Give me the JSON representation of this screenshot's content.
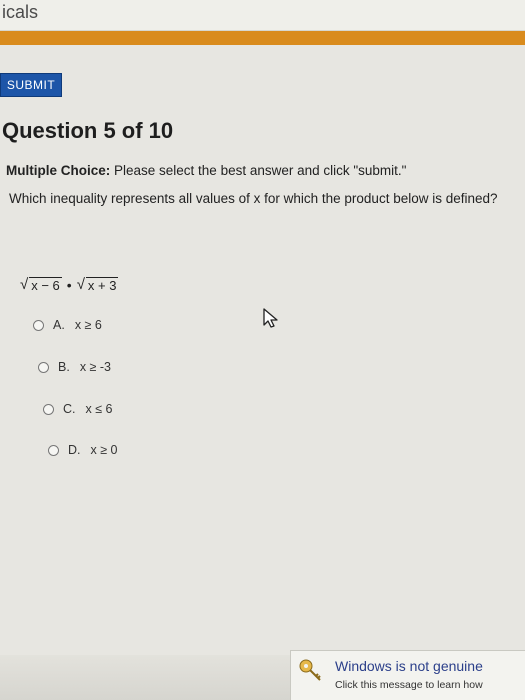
{
  "header": {
    "brand_partial": "icals"
  },
  "toolbar": {
    "submit_label": "SUBMIT"
  },
  "question": {
    "title": "Question 5 of 10",
    "instruction_bold": "Multiple Choice:",
    "instruction_rest": " Please select the best answer and click \"submit.\"",
    "prompt": "Which inequality represents all values of x for which the product below is defined?",
    "expression": {
      "radicand_1": "x − 6",
      "operator": "•",
      "radicand_2": "x + 3"
    },
    "options": [
      {
        "letter": "A.",
        "text": "x ≥ 6"
      },
      {
        "letter": "B.",
        "text": "x ≥ -3"
      },
      {
        "letter": "C.",
        "text": "x ≤ 6"
      },
      {
        "letter": "D.",
        "text": "x ≥ 0"
      }
    ]
  },
  "notification": {
    "title": "Windows is not genuine",
    "subtitle": "Click this message to learn how"
  },
  "colors": {
    "accent_orange": "#d98b1d",
    "submit_blue": "#1d55a8",
    "background": "#e7e6e1"
  },
  "icons": {
    "cursor": "arrow-cursor-icon",
    "notification": "genuine-key-icon"
  }
}
